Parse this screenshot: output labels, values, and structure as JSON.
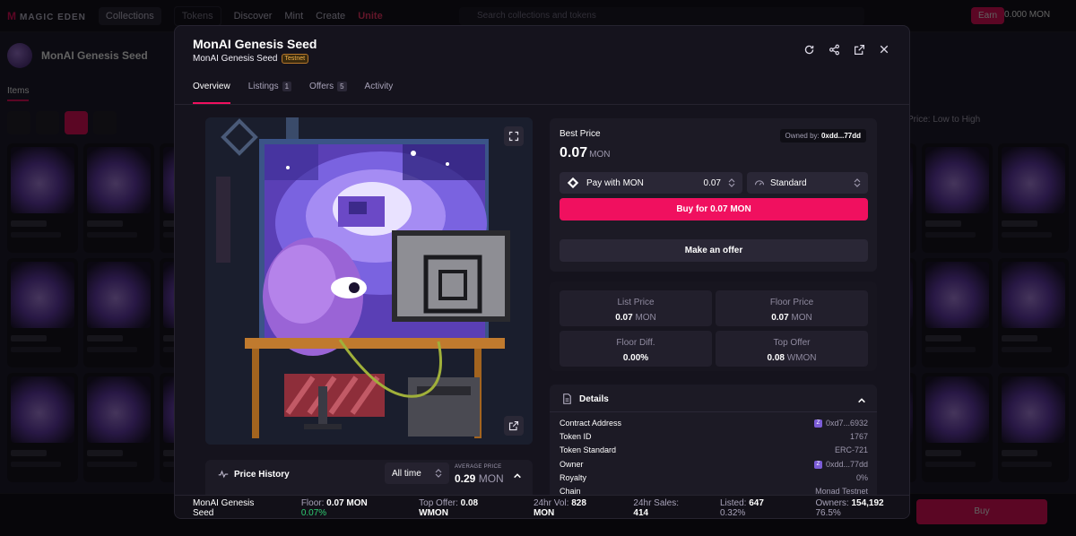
{
  "modal": {
    "title": "MonAI Genesis Seed",
    "subtitle": "MonAI Genesis Seed",
    "badge": "Testnet",
    "tabs": [
      {
        "label": "Overview",
        "count": ""
      },
      {
        "label": "Listings",
        "count": "1"
      },
      {
        "label": "Offers",
        "count": "5"
      },
      {
        "label": "Activity",
        "count": ""
      }
    ]
  },
  "best_price": {
    "label": "Best Price",
    "value": "0.07",
    "unit": "MON",
    "owned_label": "Owned by:",
    "owner": "0xdd...77dd",
    "pay_label": "Pay with MON",
    "pay_amount": "0.07",
    "speed": "Standard",
    "buy_label": "Buy for 0.07 MON",
    "offer_label": "Make an offer"
  },
  "stats": [
    {
      "label": "List Price",
      "value": "0.07",
      "unit": "MON"
    },
    {
      "label": "Floor Price",
      "value": "0.07",
      "unit": "MON"
    },
    {
      "label": "Floor Diff.",
      "value": "0.00%",
      "unit": ""
    },
    {
      "label": "Top Offer",
      "value": "0.08",
      "unit": "WMON"
    }
  ],
  "details": {
    "title": "Details",
    "rows": [
      {
        "key": "Contract Address",
        "value": "0xd7...6932",
        "chip": true
      },
      {
        "key": "Token ID",
        "value": "1767",
        "chip": false
      },
      {
        "key": "Token Standard",
        "value": "ERC-721",
        "chip": false
      },
      {
        "key": "Owner",
        "value": "0xdd...77dd",
        "chip": true
      },
      {
        "key": "Royalty",
        "value": "0%",
        "chip": false
      },
      {
        "key": "Chain",
        "value": "Monad Testnet",
        "chip": false
      }
    ]
  },
  "price_history": {
    "title": "Price History",
    "range": "All time",
    "avg_label": "AVERAGE PRICE",
    "avg_value": "0.29",
    "avg_unit": "MON"
  },
  "statusbar": {
    "name": "MonAI Genesis Seed",
    "floor_label": "Floor:",
    "floor_value": "0.07 MON",
    "floor_change": "0.07%",
    "top_offer_label": "Top Offer:",
    "top_offer_value": "0.08 WMON",
    "vol_label": "24hr Vol:",
    "vol_value": "828 MON",
    "sales_label": "24hr Sales:",
    "sales_value": "414",
    "listed_label": "Listed:",
    "listed_value": "647",
    "listed_pct": "0.32%",
    "owners_label": "Owners:",
    "owners_value": "154,192",
    "owners_pct": "76.5%"
  },
  "background": {
    "logo": "M",
    "logo_text": "MAGIC EDEN",
    "nav": [
      "Collections",
      "Tokens",
      "Discover",
      "Mint",
      "Create"
    ],
    "live": "Unite",
    "search_placeholder": "Search collections and tokens",
    "earn": "Earn",
    "balance": "0.000 MON",
    "collection_name": "MonAI Genesis Seed",
    "tab": "Items",
    "sort": "Price: Low to High",
    "footer_button": "Buy"
  },
  "colors": {
    "accent": "#f0105f",
    "panel": "#1c1a25",
    "positive": "#2ecc71"
  }
}
